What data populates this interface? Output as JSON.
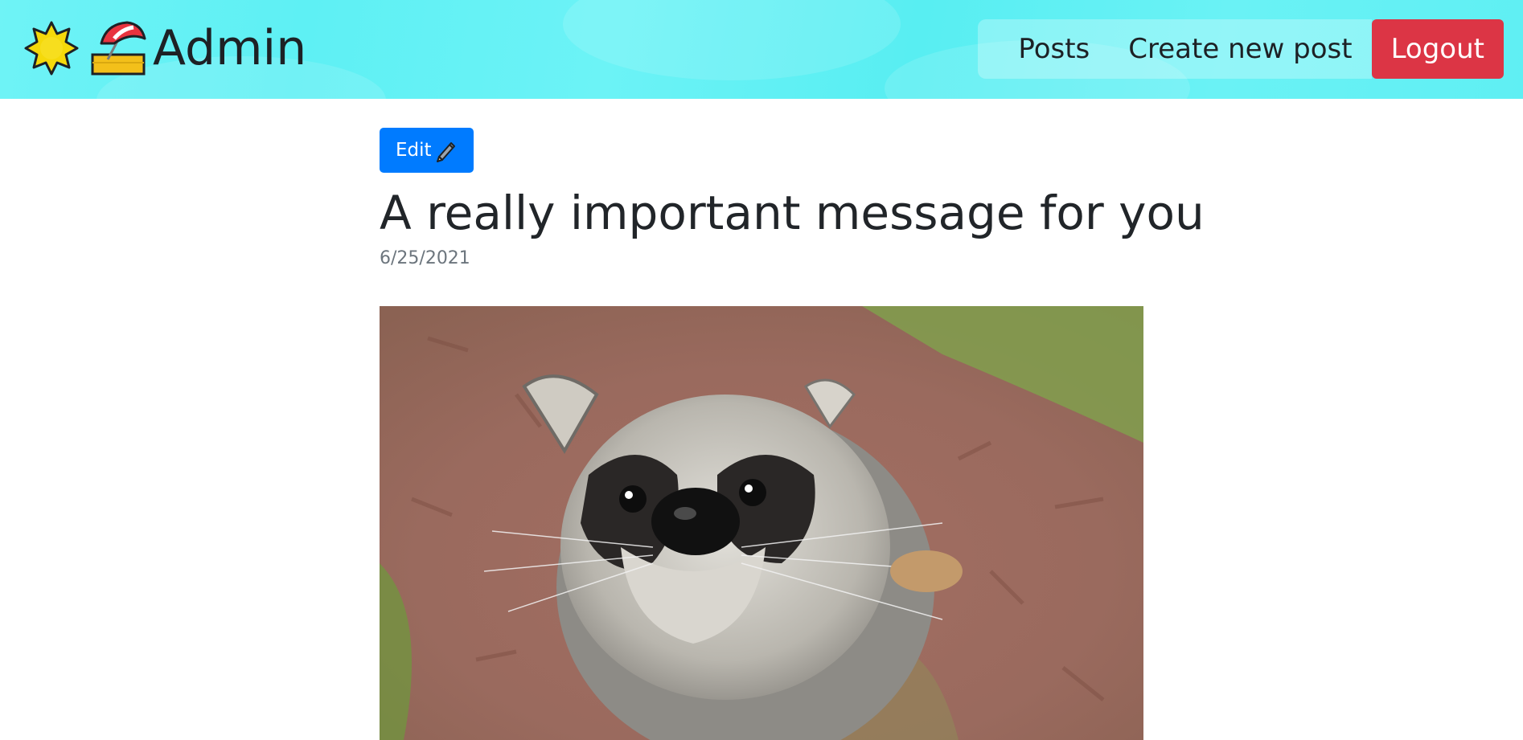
{
  "navbar": {
    "brand_title": "Admin",
    "brand_icons": [
      "sun-icon",
      "beach-umbrella-icon"
    ],
    "links": [
      {
        "label": "Posts"
      },
      {
        "label": "Create new post"
      }
    ],
    "logout_label": "Logout",
    "logout_color": "#dc3545"
  },
  "post": {
    "edit_label": "Edit",
    "edit_icon": "pencil-icon",
    "edit_color": "#007bff",
    "title": "A really important message for you",
    "date": "6/25/2021",
    "image_subject": "raccoon-photo"
  }
}
